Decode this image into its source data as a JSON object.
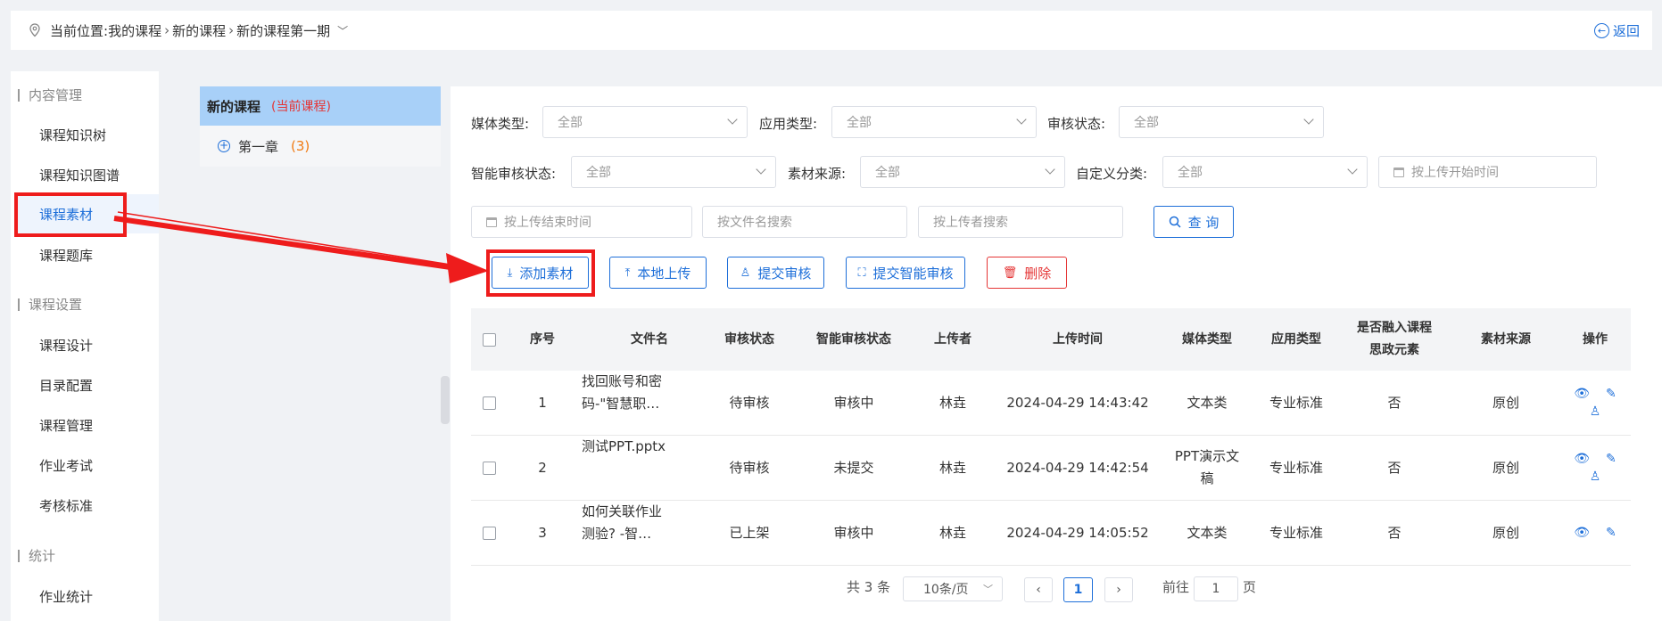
{
  "breadcrumb": {
    "label": "当前位置:",
    "items": [
      "我的课程",
      "新的课程",
      "新的课程第一期"
    ],
    "back": "返回"
  },
  "sidebar": {
    "sections": [
      {
        "title": "内容管理",
        "items": [
          "课程知识树",
          "课程知识图谱",
          "课程素材",
          "课程题库"
        ]
      },
      {
        "title": "课程设置",
        "items": [
          "课程设计",
          "目录配置",
          "课程管理",
          "作业考试",
          "考核标准"
        ]
      },
      {
        "title": "统计",
        "items": [
          "作业统计"
        ]
      }
    ],
    "active": "课程素材"
  },
  "tree": {
    "course": "新的课程",
    "current_tag": "(当前课程)",
    "chapter": "第一章",
    "chapter_count": "(3)"
  },
  "filters": {
    "media_type": {
      "label": "媒体类型:",
      "value": "全部"
    },
    "app_type": {
      "label": "应用类型:",
      "value": "全部"
    },
    "review_status": {
      "label": "审核状态:",
      "value": "全部"
    },
    "smart_review": {
      "label": "智能审核状态:",
      "value": "全部"
    },
    "source": {
      "label": "素材来源:",
      "value": "全部"
    },
    "custom_cat": {
      "label": "自定义分类:",
      "value": "全部"
    },
    "start_time": {
      "placeholder": "按上传开始时间"
    },
    "end_time": {
      "placeholder": "按上传结束时间"
    },
    "filename": {
      "placeholder": "按文件名搜索"
    },
    "uploader": {
      "placeholder": "按上传者搜索"
    },
    "query": "查 询"
  },
  "actions": {
    "add": "添加素材",
    "local_upload": "本地上传",
    "submit_review": "提交审核",
    "submit_smart": "提交智能审核",
    "delete": "删除"
  },
  "table": {
    "headers": [
      "序号",
      "文件名",
      "审核状态",
      "智能审核状态",
      "上传者",
      "上传时间",
      "媒体类型",
      "应用类型",
      "是否融入课程思政元素",
      "素材来源",
      "操作"
    ],
    "header_lines": {
      "ideology_1": "是否融入课程",
      "ideology_2": "思政元素"
    },
    "rows": [
      {
        "no": "1",
        "name1": "找回账号和密",
        "name2": "码-\"智慧职…",
        "review": "待审核",
        "smart": "审核中",
        "uploader": "林垚",
        "time": "2024-04-29 14:43:42",
        "media1": "文本类",
        "media2": "",
        "app": "专业标准",
        "ideology": "否",
        "source": "原创"
      },
      {
        "no": "2",
        "name1": "测试PPT.pptx",
        "name2": "",
        "review": "待审核",
        "smart": "未提交",
        "uploader": "林垚",
        "time": "2024-04-29 14:42:54",
        "media1": "PPT演示文",
        "media2": "稿",
        "app": "专业标准",
        "ideology": "否",
        "source": "原创"
      },
      {
        "no": "3",
        "name1": "如何关联作业",
        "name2": "测验? -智…",
        "review": "已上架",
        "smart": "审核中",
        "uploader": "林垚",
        "time": "2024-04-29 14:05:52",
        "media1": "文本类",
        "media2": "",
        "app": "专业标准",
        "ideology": "否",
        "source": "原创"
      }
    ]
  },
  "pagination": {
    "total": "共 3 条",
    "page_size": "10条/页",
    "current": "1",
    "goto_label": "前往",
    "goto_value": "1",
    "page_unit": "页"
  },
  "colors": {
    "accent": "#1e6fd9",
    "danger": "#e53535",
    "annotation": "#ee1c1c",
    "tree_head": "#a8d0f8"
  },
  "icons": [
    "location-pin-icon",
    "chevron-down-icon",
    "back-arrow-icon",
    "plus-circle-icon",
    "calendar-icon",
    "search-icon",
    "download-icon",
    "upload-icon",
    "user-icon",
    "scan-icon",
    "trash-icon",
    "eye-icon",
    "edit-icon",
    "user-add-icon",
    "chevron-left-icon",
    "chevron-right-icon"
  ]
}
